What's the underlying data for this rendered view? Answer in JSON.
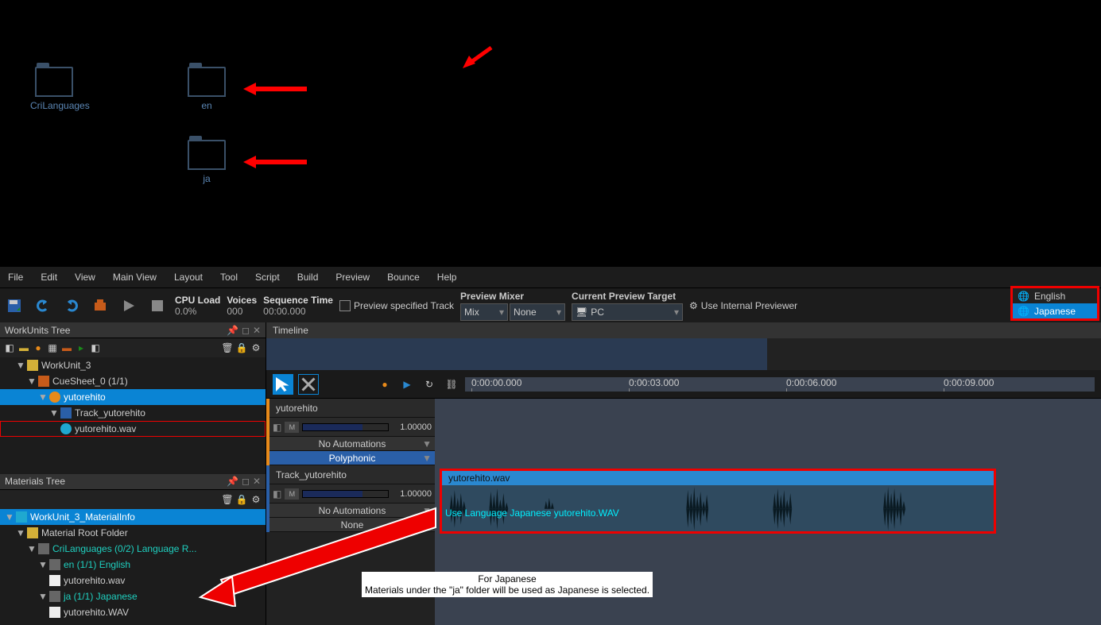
{
  "folders": {
    "f0": "CriLanguages",
    "f1": "en",
    "f2": "ja"
  },
  "menu": [
    "File",
    "Edit",
    "View",
    "Main View",
    "Layout",
    "Tool",
    "Script",
    "Build",
    "Preview",
    "Bounce",
    "Help"
  ],
  "toolbar": {
    "cpu_lbl": "CPU Load",
    "cpu_val": "0.0%",
    "voices_lbl": "Voices",
    "voices_val": "000",
    "seq_lbl": "Sequence Time",
    "seq_val": "00:00.000",
    "prev_track": "Preview specified Track",
    "mixer_lbl": "Preview Mixer",
    "mixer_mix": "Mix",
    "mixer_val": "None",
    "target_lbl": "Current Preview Target",
    "target_val": "PC",
    "use_internal": "Use Internal Previewer"
  },
  "lang": {
    "en": "English",
    "ja": "Japanese"
  },
  "panels": {
    "workunits": "WorkUnits Tree",
    "materials": "Materials Tree",
    "timeline": "Timeline"
  },
  "wu_tree": {
    "root": "WorkUnit_3",
    "sheet": "CueSheet_0 (1/1)",
    "cue": "yutorehito",
    "track": "Track_yutorehito",
    "wave": "yutorehito.wav"
  },
  "mat_tree": {
    "info": "WorkUnit_3_MaterialInfo",
    "root": "Material Root Folder",
    "crilang": "CriLanguages (0/2) Language R...",
    "en_folder": "en (1/1) English",
    "en_wav": "yutorehito.wav",
    "ja_folder": "ja (1/1) Japanese",
    "ja_wav": "yutorehito.WAV"
  },
  "track_hdr": {
    "cue": "yutorehito",
    "vol": "1.00000",
    "noauto": "No Automations",
    "poly": "Polyphonic",
    "track": "Track_yutorehito",
    "none": "None"
  },
  "ruler": {
    "t0": "0:00:00.000",
    "t1": "0:00:03.000",
    "t2": "0:00:06.000",
    "t3": "0:00:09.000"
  },
  "clip": {
    "title": "yutorehito.wav",
    "lang": "Use Language Japanese yutorehito.WAV"
  },
  "annot": {
    "line1": "For Japanese",
    "line2": "Materials under the \"ja\" folder will be used as Japanese is selected."
  }
}
